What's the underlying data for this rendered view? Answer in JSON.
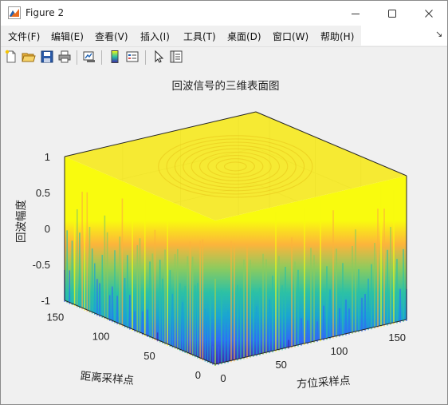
{
  "window": {
    "title": "Figure 2",
    "controls": {
      "minimize": "minimize",
      "maximize": "maximize",
      "close": "close"
    }
  },
  "menubar": {
    "items": [
      "文件(F)",
      "编辑(E)",
      "查看(V)",
      "插入(I)",
      "工具(T)",
      "桌面(D)",
      "窗口(W)",
      "帮助(H)"
    ],
    "dock_glyph": "↘"
  },
  "toolbar": {
    "icons": [
      "new-figure-icon",
      "open-file-icon",
      "save-icon",
      "print-icon",
      "link-plot-icon",
      "insert-colorbar-icon",
      "insert-legend-icon",
      "pointer-icon",
      "property-inspector-icon"
    ]
  },
  "chart_data": {
    "type": "surface",
    "title": "回波信号的三维表面图",
    "xlabel": "方位采样点",
    "ylabel": "距离采样点",
    "zlabel": "回波幅度",
    "x_ticks": [
      "0",
      "50",
      "100",
      "150"
    ],
    "y_ticks": [
      "0",
      "50",
      "100",
      "150"
    ],
    "z_ticks": [
      "-1",
      "-0.5",
      "0",
      "0.5",
      "1"
    ],
    "xlim": [
      0,
      165
    ],
    "ylim": [
      0,
      165
    ],
    "zlim": [
      -1,
      1
    ],
    "colormap": "parula",
    "colormap_stops": [
      "#3e26a8",
      "#2f6cf5",
      "#1aa5d2",
      "#2cc1a5",
      "#8ccb5e",
      "#fcb43b",
      "#f9fb0e"
    ],
    "grid": true,
    "box": true,
    "view": "3d default"
  }
}
